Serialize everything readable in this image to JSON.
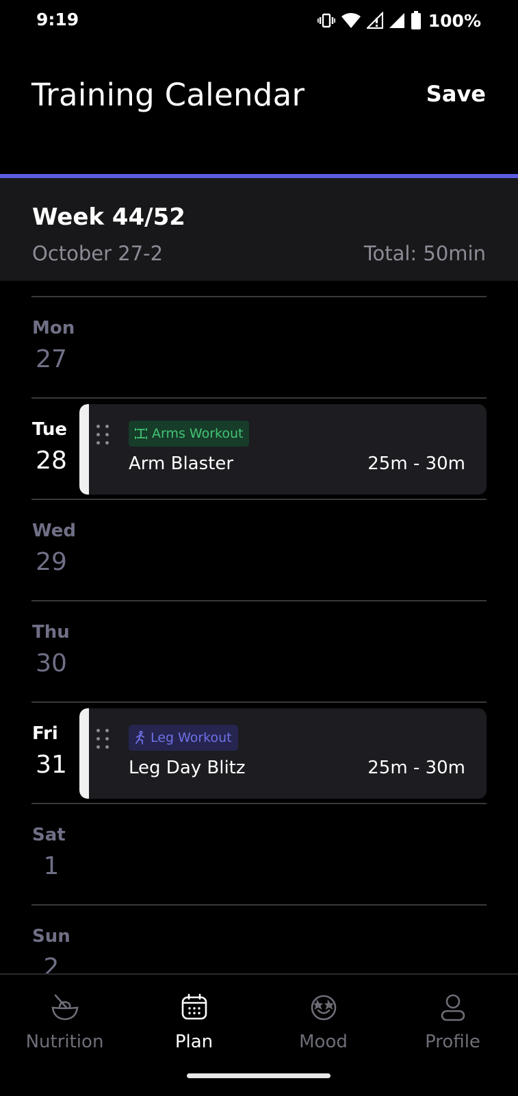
{
  "status_bar": {
    "time": "9:19",
    "battery_percent": "100%",
    "icons": [
      "vibrate-icon",
      "wifi-icon",
      "signal-icon",
      "signal-full-icon",
      "battery-icon"
    ]
  },
  "header": {
    "title": "Training Calendar",
    "save_label": "Save"
  },
  "week": {
    "title": "Week 44/52",
    "dates": "October 27-2",
    "total": "Total: 50min"
  },
  "days": [
    {
      "name": "Mon",
      "number": "27"
    },
    {
      "name": "Tue",
      "number": "28",
      "workout": {
        "tag": "Arms Workout",
        "name": "Arm Blaster",
        "duration": "25m - 30m"
      }
    },
    {
      "name": "Wed",
      "number": "29"
    },
    {
      "name": "Thu",
      "number": "30"
    },
    {
      "name": "Fri",
      "number": "31",
      "workout": {
        "tag": "Leg Workout",
        "name": "Leg Day Blitz",
        "duration": "25m - 30m"
      }
    },
    {
      "name": "Sat",
      "number": "1"
    },
    {
      "name": "Sun",
      "number": "2"
    }
  ],
  "nav": {
    "items": [
      {
        "label": "Nutrition",
        "icon": "nutrition-bowl-icon"
      },
      {
        "label": "Plan",
        "icon": "calendar-icon",
        "active": true
      },
      {
        "label": "Mood",
        "icon": "mood-face-icon"
      },
      {
        "label": "Profile",
        "icon": "profile-person-icon"
      }
    ]
  },
  "colors": {
    "accent": "#5b5ce0",
    "arms_tag_text": "#43c474",
    "arms_tag_bg": "#173c2a",
    "legs_tag_text": "#6f71e8",
    "legs_tag_bg": "#25254f",
    "muted_day": "#6f6f86"
  }
}
